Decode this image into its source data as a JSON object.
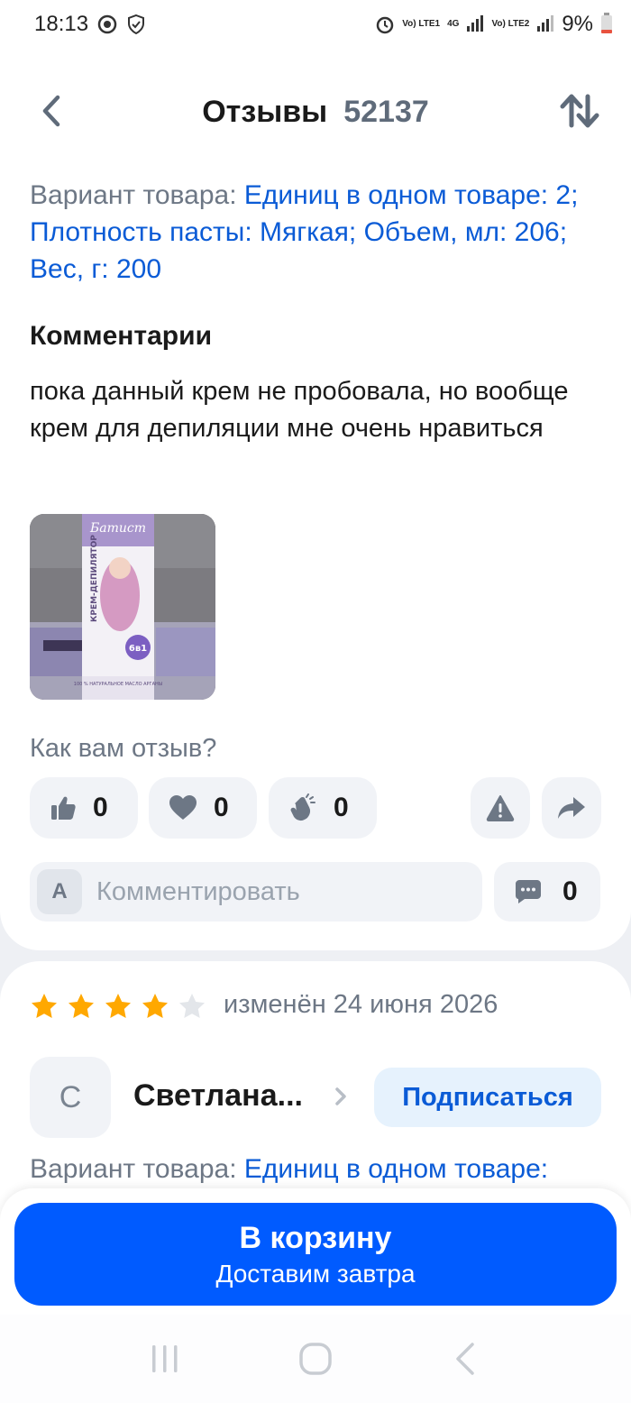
{
  "status_bar": {
    "time": "18:13",
    "battery": "9%",
    "sim1": "Vo) LTE1",
    "sim2": "Vo) LTE2",
    "network": "4G"
  },
  "header": {
    "title": "Отзывы",
    "count": "52137"
  },
  "review": {
    "variant_label": "Вариант товара:",
    "variant_value": "Единиц в одном товаре: 2; Плотность пасты: Мягкая; Объем, мл: 206; Вес, г: 200",
    "comments_title": "Комментарии",
    "comment_text": "пока данный крем не пробовала, но вообще крем для депиляции мне очень нравиться",
    "photo": {
      "brand": "Батист",
      "product": "КРЕМ-ДЕПИЛЯТОР",
      "badge": "6в1",
      "note": "100 % НАТУРАЛЬНОЕ МАСЛО АРГАНЫ"
    },
    "rate_question": "Как вам отзыв?",
    "reactions": {
      "likes": "0",
      "hearts": "0",
      "claps": "0"
    },
    "comment_input": {
      "avatar_letter": "А",
      "placeholder": "Комментировать"
    },
    "comments_count": "0"
  },
  "review2": {
    "rating": 4,
    "rating_max": 5,
    "date": "изменён 24 июня 2026",
    "author_initial": "С",
    "author_name": "Светлана...",
    "subscribe_label": "Подписаться",
    "variant_label": "Вариант товара:",
    "variant_value": "Единиц в одном товаре:"
  },
  "cart": {
    "label": "В корзину",
    "sub": "Доставим завтра"
  },
  "colors": {
    "accent": "#005bff",
    "link": "#0a5bd6",
    "star": "#ffa800",
    "muted": "#6d7785"
  }
}
